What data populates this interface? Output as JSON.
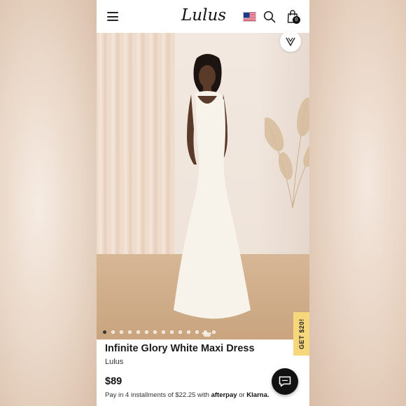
{
  "header": {
    "logo": "Lulus",
    "cart_count": "0",
    "icons": [
      "menu-icon",
      "us-flag-icon",
      "search-icon",
      "shopping-bag-icon"
    ]
  },
  "gallery": {
    "dot_count": 14,
    "active_index": 0
  },
  "promo": {
    "label": "GET $20!"
  },
  "product": {
    "title": "Infinite Glory White Maxi Dress",
    "brand": "Lulus",
    "price": "$89",
    "installments_prefix": "Pay in 4 installments of",
    "installment_amount": "$22.25",
    "installments_with": "with",
    "afterpay": "afterpay",
    "or": "or",
    "klarna": "Klarna."
  },
  "colors": {
    "promo_bg": "#f6d77b",
    "chat_bg": "#111111"
  }
}
